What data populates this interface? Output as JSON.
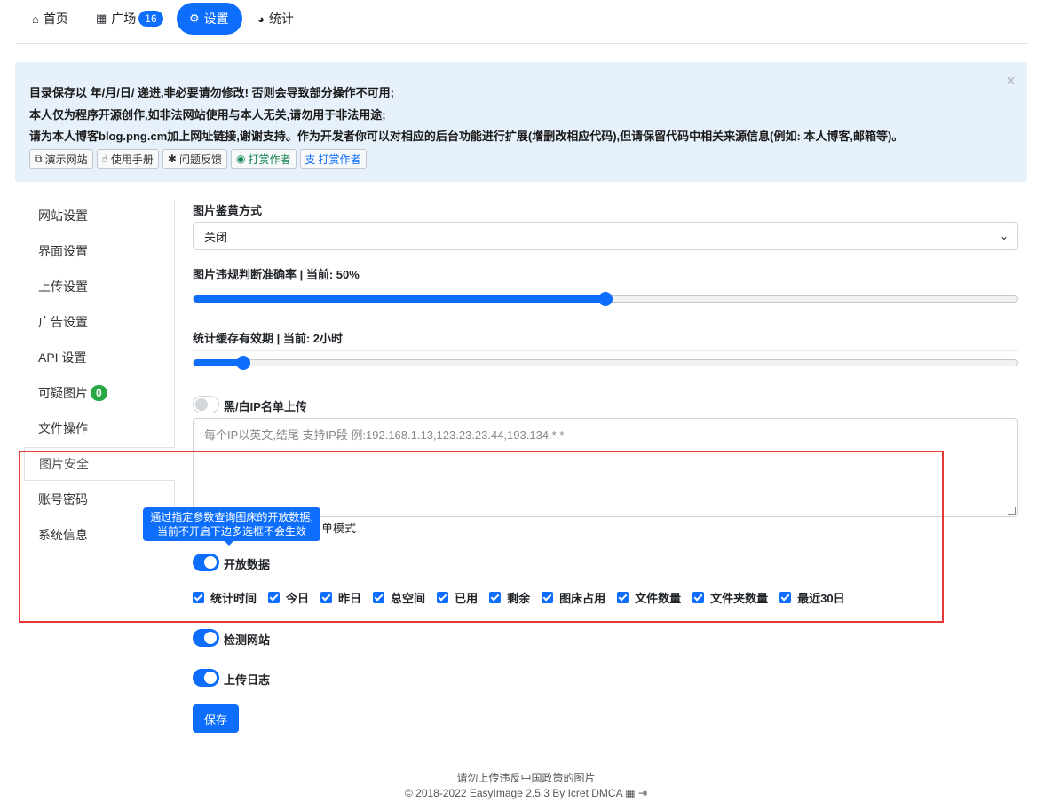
{
  "nav": {
    "home": "首页",
    "square": "广场",
    "square_badge": "16",
    "settings": "设置",
    "stats": "统计"
  },
  "alert": {
    "line1": "目录保存以 年/月/日/ 递进,非必要请勿修改! 否则会导致部分操作不可用;",
    "line2": "本人仅为程序开源创作,如非法网站使用与本人无关,请勿用于非法用途;",
    "line3": "请为本人博客blog.png.cm加上网址链接,谢谢支持。作为开发者你可以对相应的后台功能进行扩展(增删改相应代码),但请保留代码中相关来源信息(例如: 本人博客,邮箱等)。",
    "close": "x",
    "buttons": [
      "演示网站",
      "使用手册",
      "问题反馈",
      "打赏作者",
      "打赏作者"
    ]
  },
  "sidebar": {
    "items": [
      "网站设置",
      "界面设置",
      "上传设置",
      "广告设置",
      "API 设置",
      "可疑图片",
      "文件操作",
      "图片安全",
      "账号密码",
      "系统信息"
    ],
    "suspicious_badge": "0",
    "active_index": 7
  },
  "content": {
    "nsfw_label": "图片鉴黄方式",
    "nsfw_value": "关闭",
    "accuracy_label": "图片违规判断准确率 | 当前: 50%",
    "accuracy_value": 0.5,
    "cache_label": "统计缓存有效期 | 当前: 2小时",
    "cache_value": 0.06,
    "ip_toggle_label": "黑/白IP名单上传",
    "ip_toggle_on": false,
    "ip_placeholder": "每个IP以英文,结尾 支持IP段 例:192.168.1.13,123.23.23.44,193.134.*.*",
    "partial_text": "单模式",
    "tooltip_line1": "通过指定参数查询图床的开放数据,",
    "tooltip_line2": "当前不开启下边多选框不会生效",
    "open_data_label": "开放数据",
    "checks": [
      "统计时间",
      "今日",
      "昨日",
      "总空间",
      "已用",
      "剩余",
      "图床占用",
      "文件数量",
      "文件夹数量",
      "最近30日"
    ],
    "check_site_label": "检测网站",
    "upload_log_label": "上传日志",
    "save": "保存"
  },
  "footer": {
    "line1": "请勿上传违反中国政策的图片",
    "line2": "© 2018-2022 EasyImage 2.5.3 By Icret DMCA"
  },
  "colors": {
    "primary": "#0d6efd",
    "alert_bg": "#e7f1fb",
    "highlight": "#e53935",
    "badge_green": "#28a745"
  }
}
